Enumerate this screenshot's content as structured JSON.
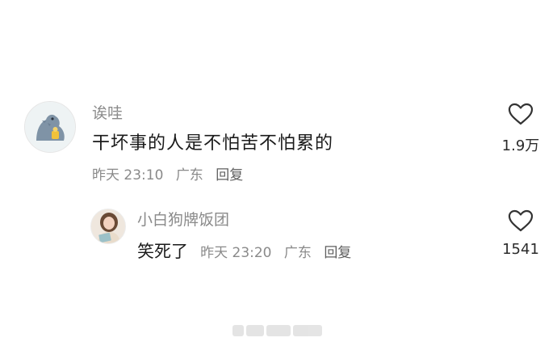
{
  "comment": {
    "username": "诶哇",
    "text": "干坏事的人是不怕苦不怕累的",
    "time": "昨天 23:10",
    "location": "广东",
    "reply_label": "回复",
    "like_count": "1.9万",
    "avatar_icon": "gray-dinosaur-avatar"
  },
  "reply": {
    "username": "小白狗牌饭团",
    "text": "笑死了",
    "time": "昨天 23:20",
    "location": "广东",
    "reply_label": "回复",
    "like_count": "1541",
    "avatar_icon": "girl-with-book-avatar"
  },
  "icons": {
    "like": "heart-outline-icon"
  },
  "colors": {
    "primary_text": "#1a1a1a",
    "secondary_text": "#8a8a8a",
    "icon_stroke": "#333333"
  }
}
